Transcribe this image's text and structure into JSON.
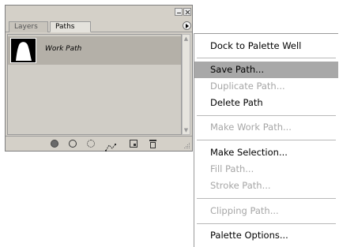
{
  "palette": {
    "tabs": [
      {
        "label": "Layers",
        "active": false
      },
      {
        "label": "Paths",
        "active": true
      }
    ],
    "paths": [
      {
        "name": "Work Path",
        "selected": true
      }
    ],
    "bottom_bar_icons": [
      "fill-path-icon",
      "stroke-path-icon",
      "load-selection-icon",
      "make-work-path-icon",
      "new-path-icon",
      "trash-icon"
    ]
  },
  "menu": {
    "highlight_color": "#a8a8a8",
    "items": [
      {
        "label": "Dock to Palette Well",
        "enabled": true
      },
      {
        "label": "Save Path...",
        "enabled": true,
        "highlighted": true
      },
      {
        "label": "Duplicate Path...",
        "enabled": false
      },
      {
        "label": "Delete Path",
        "enabled": true
      },
      {
        "label": "Make Work Path...",
        "enabled": false
      },
      {
        "label": "Make Selection...",
        "enabled": true
      },
      {
        "label": "Fill Path...",
        "enabled": false
      },
      {
        "label": "Stroke Path...",
        "enabled": false
      },
      {
        "label": "Clipping Path...",
        "enabled": false
      },
      {
        "label": "Palette Options...",
        "enabled": true
      }
    ]
  }
}
